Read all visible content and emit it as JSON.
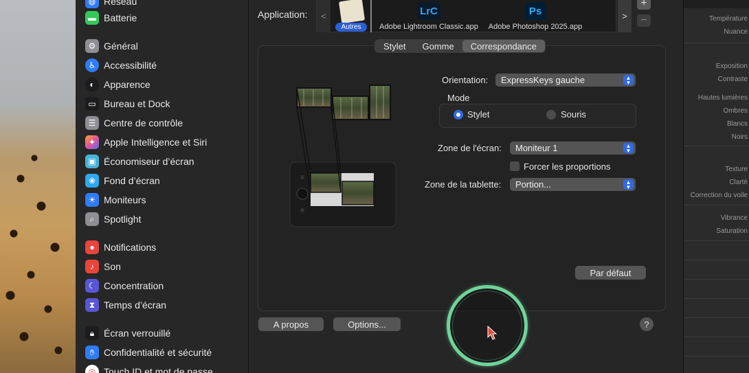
{
  "sidebar": {
    "items": [
      {
        "label": "Réseau",
        "icon": "globe-icon",
        "color": "#2f7cf6"
      },
      {
        "label": "Batterie",
        "icon": "battery-icon",
        "color": "#34c759"
      },
      {
        "label": "Général",
        "icon": "gear-icon",
        "color": "#8e8e93"
      },
      {
        "label": "Accessibilité",
        "icon": "accessibility-icon",
        "color": "#2f7cf6"
      },
      {
        "label": "Apparence",
        "icon": "appearance-icon",
        "color": "#1c1c1e"
      },
      {
        "label": "Bureau et Dock",
        "icon": "dock-icon",
        "color": "#1c1c1e"
      },
      {
        "label": "Centre de contrôle",
        "icon": "control-center-icon",
        "color": "#8e8e93"
      },
      {
        "label": "Apple Intelligence et Siri",
        "icon": "siri-icon",
        "color": "#e0569a"
      },
      {
        "label": "Économiseur d’écran",
        "icon": "screensaver-icon",
        "color": "#49b3d8"
      },
      {
        "label": "Fond d’écran",
        "icon": "wallpaper-icon",
        "color": "#2fa9f0"
      },
      {
        "label": "Moniteurs",
        "icon": "display-icon",
        "color": "#2f7cf6"
      },
      {
        "label": "Spotlight",
        "icon": "spotlight-icon",
        "color": "#8e8e93"
      },
      {
        "label": "Notifications",
        "icon": "notifications-icon",
        "color": "#e8453c"
      },
      {
        "label": "Son",
        "icon": "sound-icon",
        "color": "#e8453c"
      },
      {
        "label": "Concentration",
        "icon": "focus-icon",
        "color": "#5856d6"
      },
      {
        "label": "Temps d’écran",
        "icon": "screen-time-icon",
        "color": "#5856d6"
      },
      {
        "label": "Écran verrouillé",
        "icon": "lock-icon",
        "color": "#1c1c1e"
      },
      {
        "label": "Confidentialité et sécurité",
        "icon": "privacy-hand-icon",
        "color": "#2f7cf6"
      },
      {
        "label": "Touch ID et mot de passe",
        "icon": "touch-id-icon",
        "color": "#e8453c"
      }
    ]
  },
  "application": {
    "label": "Application:",
    "others_badge": "Autres",
    "apps": [
      "Adobe Lightroom Classic.app",
      "Adobe Photoshop 2025.app"
    ],
    "lrc_logo": "LrC",
    "ps_logo": "Ps",
    "prev": "<",
    "next": ">",
    "plus": "+",
    "minus": "−"
  },
  "tabs": [
    "Stylet",
    "Gomme",
    "Correspondance"
  ],
  "active_tab": "Correspondance",
  "orientation": {
    "label": "Orientation:",
    "value": "ExpressKeys gauche"
  },
  "mode": {
    "title": "Mode",
    "options": [
      "Stylet",
      "Souris"
    ],
    "selected": "Stylet"
  },
  "screen_zone": {
    "label": "Zone de l'écran:",
    "value": "Moniteur 1"
  },
  "force_proportions": {
    "label": "Forcer les proportions",
    "checked": false
  },
  "tablet_zone": {
    "label": "Zone de la tablette:",
    "value": "Portion..."
  },
  "buttons": {
    "default": "Par défaut",
    "about": "A propos",
    "options": "Options...",
    "help": "?"
  },
  "lightroom_panel": {
    "labels": [
      "Température",
      "Nuance",
      "Exposition",
      "Contraste",
      "Hautes lumières",
      "Ombres",
      "Blancs",
      "Noirs",
      "Texture",
      "Clarté",
      "Correction du voile",
      "Vibrance",
      "Saturation"
    ]
  },
  "colors": {
    "accent": "#2f6ae0",
    "click_ring": "#6fd49a"
  }
}
